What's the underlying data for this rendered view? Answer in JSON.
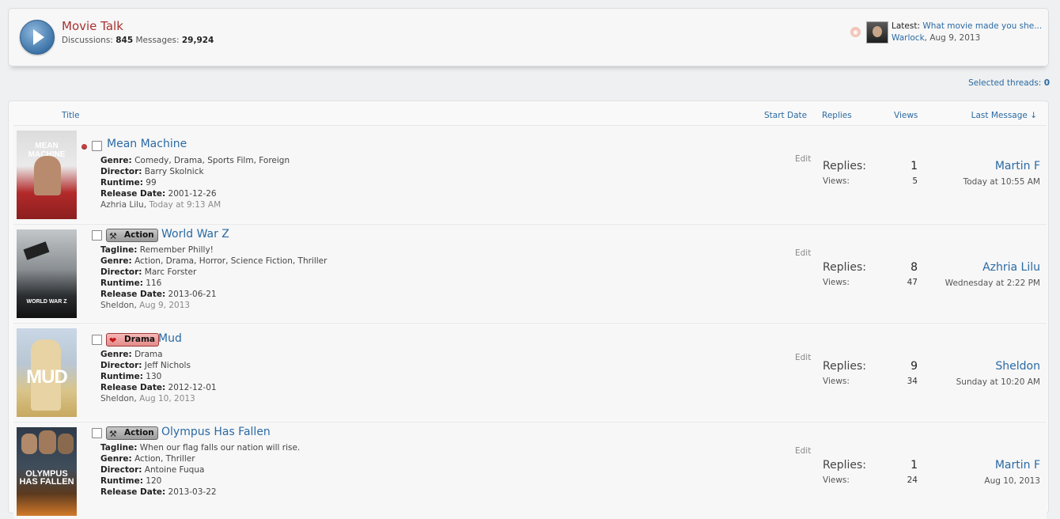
{
  "forum": {
    "title": "Movie Talk",
    "discussions_label": "Discussions:",
    "discussions": "845",
    "messages_label": "Messages:",
    "messages": "29,924",
    "latest_label": "Latest:",
    "latest_thread": "What movie made you she...",
    "latest_user": "Warlock",
    "latest_date": ", Aug 9, 2013"
  },
  "selected_threads": {
    "label": "Selected threads:",
    "count": "0"
  },
  "columns": {
    "title": "Title",
    "start_date": "Start Date",
    "replies": "Replies",
    "views": "Views",
    "last_message": "Last Message ↓"
  },
  "threads": [
    {
      "title": "Mean Machine",
      "poster_text": "MEAN MACHINE",
      "prefix": "",
      "tagline": "",
      "genre": "Comedy, Drama, Sports Film, Foreign",
      "director": "Barry Skolnick",
      "runtime": "99",
      "release_date": "2001-12-26",
      "starter": "Azhria Lilu",
      "start_date": "Today at 9:13 AM",
      "replies": "1",
      "views": "5",
      "last_user": "Martin F",
      "last_time": "Today at 10:55 AM"
    },
    {
      "title": "World War Z",
      "poster_text": "WORLD WAR Z",
      "prefix": "Action",
      "tagline": "Remember Philly!",
      "genre": "Action, Drama, Horror, Science Fiction, Thriller",
      "director": "Marc Forster",
      "runtime": "116",
      "release_date": "2013-06-21",
      "starter": "Sheldon",
      "start_date": "Aug 9, 2013",
      "replies": "8",
      "views": "47",
      "last_user": "Azhria Lilu",
      "last_time": "Wednesday at 2:22 PM"
    },
    {
      "title": "Mud",
      "poster_text": "MUD",
      "prefix": "Drama",
      "tagline": "",
      "genre": "Drama",
      "director": "Jeff Nichols",
      "runtime": "130",
      "release_date": "2012-12-01",
      "starter": "Sheldon",
      "start_date": "Aug 10, 2013",
      "replies": "9",
      "views": "34",
      "last_user": "Sheldon",
      "last_time": "Sunday at 10:20 AM"
    },
    {
      "title": "Olympus Has Fallen",
      "poster_text": "OLYMPUS HAS FALLEN",
      "prefix": "Action",
      "tagline": "When our flag falls our nation will rise.",
      "genre": "Action, Thriller",
      "director": "Antoine Fuqua",
      "runtime": "120",
      "release_date": "2013-03-22",
      "starter": "",
      "start_date": "",
      "replies": "1",
      "views": "24",
      "last_user": "Martin F",
      "last_time": "Aug 10, 2013"
    }
  ],
  "labels": {
    "tagline": "Tagline:",
    "genre": "Genre:",
    "director": "Director:",
    "runtime": "Runtime:",
    "release_date": "Release Date:",
    "edit": "Edit",
    "replies": "Replies:",
    "views": "Views:"
  }
}
